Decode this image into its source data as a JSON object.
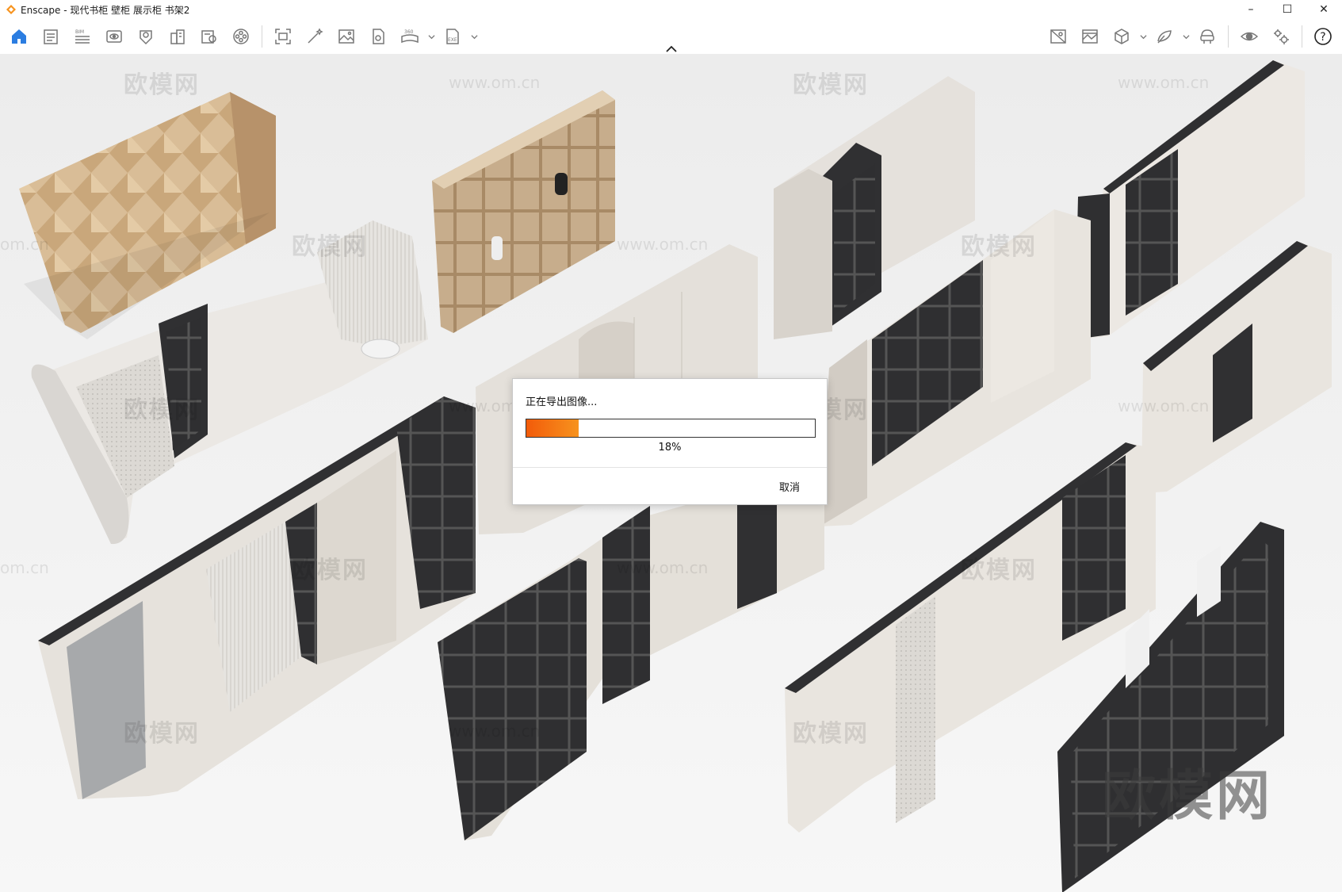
{
  "window": {
    "title": "Enscape - 现代书柜 壁柜 展示柜 书架2",
    "controls": {
      "minimize": "–",
      "maximize": "☐",
      "close": "✕"
    }
  },
  "toolbar": {
    "left_icons": [
      "home-icon",
      "notes-icon",
      "bim-icon",
      "visual-settings-icon",
      "atmosphere-icon",
      "buildings-icon",
      "asset-library-icon",
      "video-editor-icon",
      "screenshot-icon",
      "magic-edit-icon",
      "image-export-icon",
      "batch-render-icon",
      "panorama-360-icon",
      "exe-export-icon"
    ],
    "right_icons": [
      "views-icon",
      "gallery-icon",
      "cube-view-icon",
      "live-link-icon",
      "vr-headset-icon",
      "eye-icon",
      "settings-icon",
      "help-icon"
    ],
    "bim_label": "BIM",
    "pano_label": "360",
    "exe_label": "EXE",
    "help_label": "?"
  },
  "watermarks": {
    "logo_text": "欧模网",
    "url_text": "www.om.cn",
    "url_fragment": "om.cn",
    "big_text": "欧模网"
  },
  "dialog": {
    "message": "正在导出图像...",
    "progress_percent": 18,
    "progress_label": "18%",
    "cancel_label": "取消"
  },
  "colors": {
    "accent": "#2b7de1",
    "progress_start": "#f25b0a",
    "progress_end": "#f7931e",
    "logo": "#f7931e"
  }
}
